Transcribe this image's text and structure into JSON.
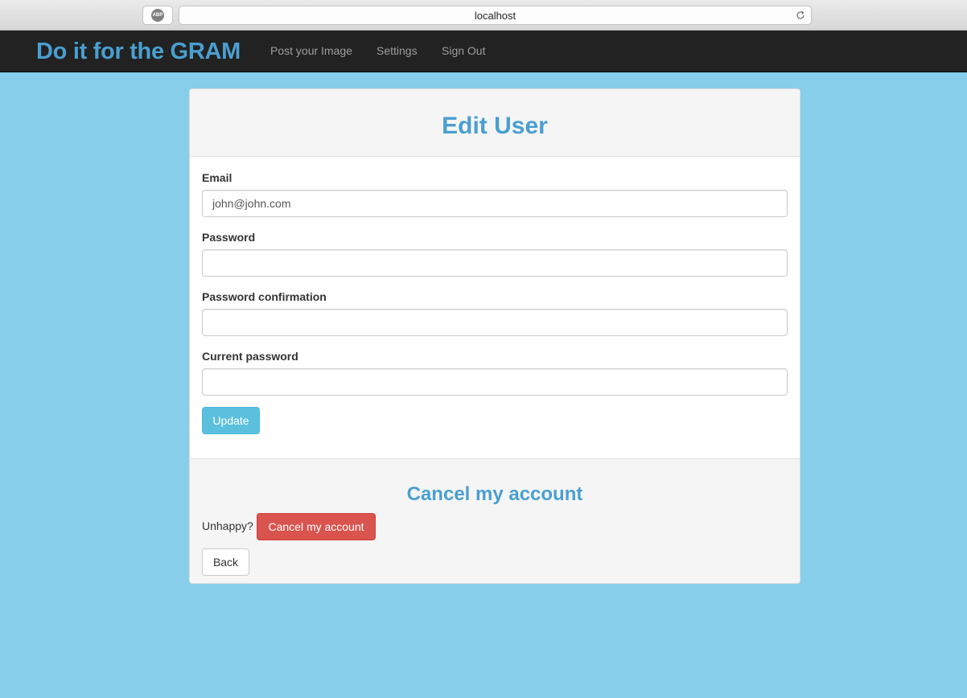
{
  "browser": {
    "url": "localhost",
    "adblock_label": "ABP"
  },
  "navbar": {
    "brand": "Do it for the GRAM",
    "links": [
      "Post your Image",
      "Settings",
      "Sign Out"
    ]
  },
  "form": {
    "title": "Edit User",
    "email_label": "Email",
    "email_value": "john@john.com",
    "password_label": "Password",
    "password_confirmation_label": "Password confirmation",
    "current_password_label": "Current password",
    "update_label": "Update"
  },
  "cancel_section": {
    "title": "Cancel my account",
    "prompt": "Unhappy?",
    "cancel_label": "Cancel my account",
    "back_label": "Back"
  },
  "colors": {
    "page_background": "#87ceeb",
    "brand": "#4a9fd1",
    "update_button": "#5bc0de",
    "cancel_button": "#d9534f"
  }
}
